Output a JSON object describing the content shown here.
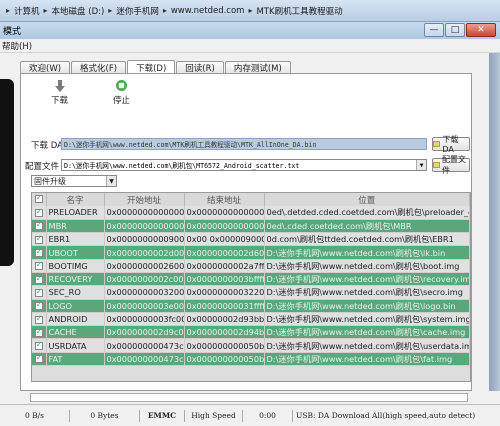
{
  "breadcrumb": [
    "计算机",
    "本地磁盘 (D:)",
    "迷你手机网",
    "www.netded.com",
    "MTK刷机工具教程驱动"
  ],
  "window": {
    "title": "模式",
    "min": "—",
    "max": "□",
    "close": "✕"
  },
  "menu": [
    "帮助(H)"
  ],
  "tabs": [
    "欢迎(W)",
    "格式化(F)",
    "下载(D)",
    "回读(R)",
    "内存测试(M)"
  ],
  "toolbar": {
    "download": "下载",
    "stop": "停止"
  },
  "files": {
    "da_label": "下载 DA",
    "da_value": "D:\\迷你手机网\\www.netded.com\\MTK刷机工具教程驱动\\MTK_AllInOne_DA.bin",
    "da_button": "下载 DA",
    "scatter_label": "配置文件",
    "scatter_value": "D:\\迷你手机网\\www.netded.com\\刷机包\\MT6572_Android_scatter.txt",
    "scatter_button": "配置文件"
  },
  "mode": {
    "selected": "固件升级"
  },
  "table": {
    "headers": [
      "",
      "名字",
      "开始地址",
      "结束地址",
      "位置"
    ],
    "rows": [
      {
        "checked": true,
        "name": "PRELOADER",
        "start": "0x0000000000000000",
        "end": "0x0000000000000000",
        "loc": "0ed\\.detded.cded.coetded.com\\刷机包\\preloader_gionee72_...",
        "style": "gray"
      },
      {
        "checked": true,
        "name": "MBR",
        "start": "0x0000000000000000",
        "end": "0x0000000000000000",
        "loc": "0ed\\.cded.coetded.com\\刷机包\\MBR",
        "style": "green"
      },
      {
        "checked": true,
        "name": "EBR1",
        "start": "0x0000000000900000",
        "end": "0x00   0x0000090000",
        "loc": "0d.com\\刷机包ttded.coetded.com\\刷机包\\EBR1",
        "style": "gray"
      },
      {
        "checked": true,
        "name": "UBOOT",
        "start": "0x0000000002d00000",
        "end": "0x0000000002d60000",
        "loc": "D:\\迷你手机网\\www.netded.com\\刷机包\\lk.bin",
        "style": "green"
      },
      {
        "checked": true,
        "name": "BOOTIMG",
        "start": "0x0000000002600000",
        "end": "0x0000000002a7ffff",
        "loc": "D:\\迷你手机网\\www.netded.com\\刷机包\\boot.img",
        "style": "gray"
      },
      {
        "checked": true,
        "name": "RECOVERY",
        "start": "0x0000000002c00000",
        "end": "0x0000000003bffff",
        "loc": "D:\\迷你手机网\\www.netded.com\\刷机包\\recovery.img",
        "style": "green"
      },
      {
        "checked": true,
        "name": "SEC_RO",
        "start": "0x0000000003200000",
        "end": "0x0000000003220fff",
        "loc": "D:\\迷你手机网\\www.netded.com\\刷机包\\secro.img",
        "style": "gray"
      },
      {
        "checked": true,
        "name": "LOGO",
        "start": "0x0000000003e00000",
        "end": "0x00000000031fffff",
        "loc": "D:\\迷你手机网\\www.netded.com\\刷机包\\logo.bin",
        "style": "green"
      },
      {
        "checked": true,
        "name": "ANDROID",
        "start": "0x0000000003fc0000",
        "end": "0x00000002d93bbb7",
        "loc": "D:\\迷你手机网\\www.netded.com\\刷机包\\system.img",
        "style": "gray"
      },
      {
        "checked": true,
        "name": "CACHE",
        "start": "0x000000002d9c0000",
        "end": "0x000000002d94b70",
        "loc": "D:\\迷你手机网\\www.netded.com\\刷机包\\cache.img",
        "style": "green"
      },
      {
        "checked": true,
        "name": "USRDATA",
        "start": "0x000000000473c0000",
        "end": "0x000000000050b6f24f",
        "loc": "D:\\迷你手机网\\www.netded.com\\刷机包\\userdata.img",
        "style": "gray"
      },
      {
        "checked": true,
        "name": "FAT",
        "start": "0x000000000473c0000",
        "end": "0x000000000050b6f24f",
        "loc": "D:\\迷你手机网\\www.netded.com\\刷机包\\fat.img",
        "style": "green"
      }
    ]
  },
  "status": [
    "0 B/s",
    "0 Bytes",
    "EMMC",
    "High Speed",
    "0:00",
    "USB: DA Download All(high speed,auto detect)"
  ]
}
